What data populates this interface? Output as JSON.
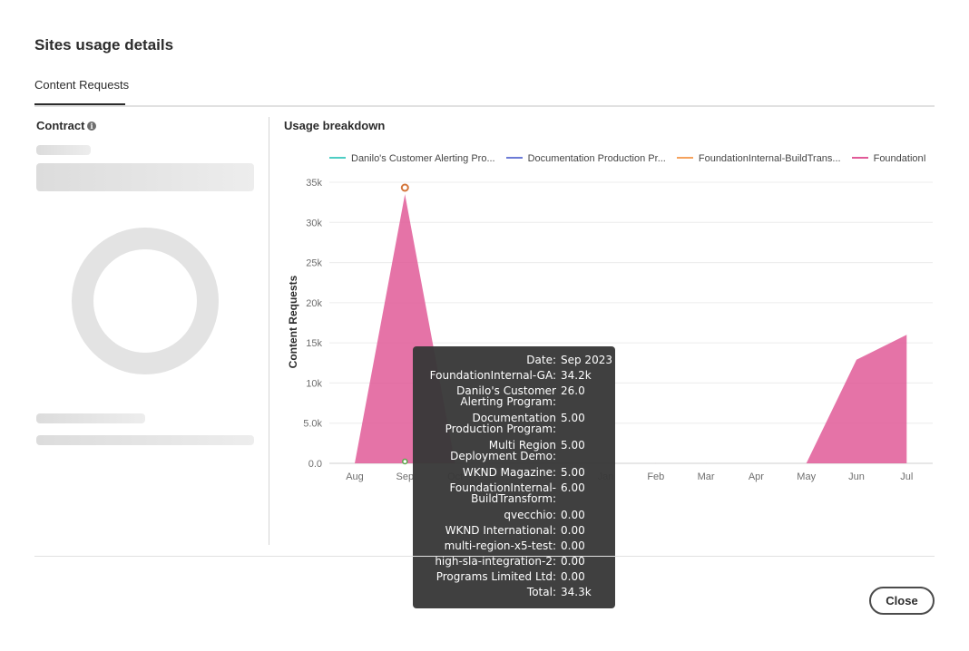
{
  "dialog": {
    "title": "Sites usage details"
  },
  "tabs": [
    {
      "label": "Content Requests"
    }
  ],
  "contract": {
    "title": "Contract",
    "info_icon": "info-icon"
  },
  "usage": {
    "title": "Usage breakdown"
  },
  "legend": [
    {
      "label": "Danilo's Customer Alerting Pro...",
      "color": "#4ecdc4"
    },
    {
      "label": "Documentation Production Pr...",
      "color": "#6c7bd6"
    },
    {
      "label": "FoundationInternal-BuildTrans...",
      "color": "#f5a25d"
    },
    {
      "label": "FoundationI",
      "color": "#e15a98"
    }
  ],
  "chart_data": {
    "type": "area",
    "ylabel": "Content Requests",
    "ylim": [
      0,
      35000
    ],
    "yticks": [
      "0.0",
      "5.0k",
      "10k",
      "15k",
      "20k",
      "25k",
      "30k",
      "35k"
    ],
    "categories": [
      "Aug",
      "Sep",
      "Oct",
      "Nov",
      "Dec",
      "Jan",
      "Feb",
      "Mar",
      "Apr",
      "May",
      "Jun",
      "Jul"
    ],
    "visible_tick_labels": [
      "Aug",
      "Sep",
      "Oct",
      "",
      "",
      "Jan",
      "Feb",
      "Mar",
      "Apr",
      "May",
      "Jun",
      "Jul"
    ],
    "series": [
      {
        "name": "FoundationI",
        "color": "#e15a98",
        "values": [
          0,
          33500,
          0,
          0,
          0,
          0,
          0,
          0,
          0,
          0,
          12900,
          16000
        ]
      }
    ],
    "grid": true,
    "legend_position": "top"
  },
  "tooltip": {
    "rows": [
      {
        "key": "Date:",
        "value": "Sep 2023"
      },
      {
        "key": "FoundationInternal-GA:",
        "value": "34.2k"
      },
      {
        "key": "Danilo's Customer Alerting Program:",
        "value": "26.0"
      },
      {
        "key": "Documentation Production Program:",
        "value": "5.00"
      },
      {
        "key": "Multi Region Deployment Demo:",
        "value": "5.00"
      },
      {
        "key": "WKND Magazine:",
        "value": "5.00"
      },
      {
        "key": "FoundationInternal-BuildTransform:",
        "value": "6.00"
      },
      {
        "key": "qvecchio:",
        "value": "0.00"
      },
      {
        "key": "WKND International:",
        "value": "0.00"
      },
      {
        "key": "multi-region-x5-test:",
        "value": "0.00"
      },
      {
        "key": "high-sla-integration-2:",
        "value": "0.00"
      },
      {
        "key": "Programs Limited Ltd:",
        "value": "0.00"
      },
      {
        "key": "Total:",
        "value": "34.3k"
      }
    ]
  },
  "footer": {
    "close_label": "Close"
  }
}
